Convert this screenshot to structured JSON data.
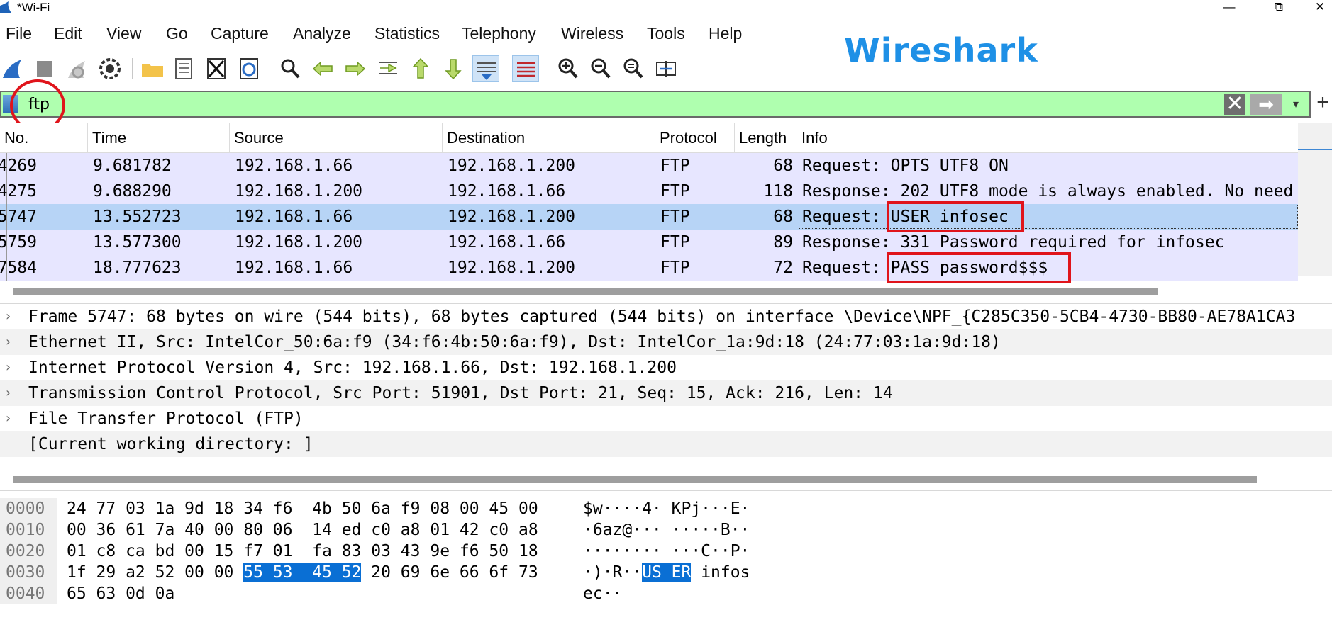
{
  "window": {
    "title": "*Wi-Fi",
    "minimize": "—",
    "maximize": "⧉",
    "close": "✕"
  },
  "menu": [
    "File",
    "Edit",
    "View",
    "Go",
    "Capture",
    "Analyze",
    "Statistics",
    "Telephony",
    "Wireless",
    "Tools",
    "Help"
  ],
  "brand": "Wireshark",
  "colors": {
    "brand": "#1e90e6",
    "filter_bg": "#afffaf",
    "row_bg": "#e7e6ff",
    "row_selected": "#b7d4f6",
    "annotation": "#e0141b",
    "hex_highlight": "#0a6fd4"
  },
  "toolbar": [
    "shark-fin-start-icon",
    "stop-capture-icon",
    "restart-capture-icon",
    "capture-options-gear-icon",
    "open-folder-icon",
    "file-set-icon",
    "close-file-icon",
    "reload-icon",
    "find-packet-icon",
    "go-back-icon",
    "go-forward-icon",
    "go-to-packet-icon",
    "first-packet-icon",
    "last-packet-icon",
    "autoscroll-icon",
    "colorize-icon",
    "zoom-in-icon",
    "zoom-out-icon",
    "normal-size-icon",
    "resize-columns-icon"
  ],
  "filter": {
    "value": "ftp",
    "clear": "✕",
    "apply": "➡",
    "dropdown": "▾",
    "add": "+"
  },
  "packet_list": {
    "columns": [
      "No.",
      "Time",
      "Source",
      "Destination",
      "Protocol",
      "Length",
      "Info"
    ],
    "rows": [
      {
        "no": "4269",
        "time": "9.681782",
        "src": "192.168.1.66",
        "dst": "192.168.1.200",
        "proto": "FTP",
        "len": "68",
        "info": "Request: OPTS UTF8 ON"
      },
      {
        "no": "4275",
        "time": "9.688290",
        "src": "192.168.1.200",
        "dst": "192.168.1.66",
        "proto": "FTP",
        "len": "118",
        "info": "Response: 202 UTF8 mode is always enabled. No need"
      },
      {
        "no": "5747",
        "time": "13.552723",
        "src": "192.168.1.66",
        "dst": "192.168.1.200",
        "proto": "FTP",
        "len": "68",
        "info": "Request: USER infosec"
      },
      {
        "no": "5759",
        "time": "13.577300",
        "src": "192.168.1.200",
        "dst": "192.168.1.66",
        "proto": "FTP",
        "len": "89",
        "info": "Response: 331 Password required for infosec"
      },
      {
        "no": "7584",
        "time": "18.777623",
        "src": "192.168.1.66",
        "dst": "192.168.1.200",
        "proto": "FTP",
        "len": "72",
        "info": "Request: PASS password$$$"
      }
    ],
    "selected": "5747"
  },
  "details": [
    {
      "arrow": "›",
      "text": "Frame 5747: 68 bytes on wire (544 bits), 68 bytes captured (544 bits) on interface \\Device\\NPF_{C285C350-5CB4-4730-BB80-AE78A1CA3"
    },
    {
      "arrow": "›",
      "text": "Ethernet II, Src: IntelCor_50:6a:f9 (34:f6:4b:50:6a:f9), Dst: IntelCor_1a:9d:18 (24:77:03:1a:9d:18)"
    },
    {
      "arrow": "›",
      "text": "Internet Protocol Version 4, Src: 192.168.1.66, Dst: 192.168.1.200"
    },
    {
      "arrow": "›",
      "text": "Transmission Control Protocol, Src Port: 51901, Dst Port: 21, Seq: 15, Ack: 216, Len: 14"
    },
    {
      "arrow": "›",
      "text": "File Transfer Protocol (FTP)"
    },
    {
      "arrow": "",
      "text": "[Current working directory: ]"
    }
  ],
  "hex": [
    {
      "offset": "0000",
      "pre": "24 77 03 1a 9d 18 34 f6  4b 50 6a f9 08 00 45 00",
      "hl": "",
      "post": "",
      "apre": "$w····4· KPj···E·",
      "ahl": "",
      "apost": ""
    },
    {
      "offset": "0010",
      "pre": "00 36 61 7a 40 00 80 06  14 ed c0 a8 01 42 c0 a8",
      "hl": "",
      "post": "",
      "apre": "·6az@··· ·····B··",
      "ahl": "",
      "apost": ""
    },
    {
      "offset": "0020",
      "pre": "01 c8 ca bd 00 15 f7 01  fa 83 03 43 9e f6 50 18",
      "hl": "",
      "post": "",
      "apre": "········ ···C··P·",
      "ahl": "",
      "apost": ""
    },
    {
      "offset": "0030",
      "pre": "1f 29 a2 52 00 00 ",
      "hl": "55 53  45 52",
      "post": " 20 69 6e 66 6f 73",
      "apre": "·)·R··",
      "ahl": "US ER",
      "apost": " infos"
    },
    {
      "offset": "0040",
      "pre": "65 63 0d 0a",
      "hl": "",
      "post": "",
      "apre": "ec··",
      "ahl": "",
      "apost": ""
    }
  ]
}
